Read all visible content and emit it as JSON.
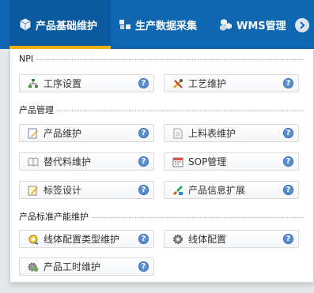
{
  "nav": {
    "tabs": [
      {
        "label": "",
        "active": false
      },
      {
        "label": "产品基础维护",
        "active": true,
        "icon": "cube-icon"
      },
      {
        "label": "生产数据采集",
        "active": false,
        "icon": "cube-stack-icon"
      },
      {
        "label": "WMS管理",
        "active": false,
        "icon": "cubes-icon"
      }
    ],
    "next_icon": "chevron-right-icon"
  },
  "colors": {
    "nav_bg": "#0f66b1",
    "active_underline": "#f2b211",
    "help": "#5b8fd0"
  },
  "sections": [
    {
      "title": "NPI",
      "items": [
        {
          "label": "工序设置",
          "icon": "tree-structure-icon"
        },
        {
          "label": "工艺维护",
          "icon": "tools-icon"
        }
      ]
    },
    {
      "title": "产品管理",
      "items": [
        {
          "label": "产品维护",
          "icon": "edit-document-icon"
        },
        {
          "label": "上料表维护",
          "icon": "document-icon"
        },
        {
          "label": "替代料维护",
          "icon": "book-icon"
        },
        {
          "label": "SOP管理",
          "icon": "calendar-icon"
        },
        {
          "label": "标签设计",
          "icon": "label-edit-icon"
        },
        {
          "label": "产品信息扩展",
          "icon": "palette-brush-icon"
        }
      ]
    },
    {
      "title": "产品标准产能维护",
      "items": [
        {
          "label": "线体配置类型维护",
          "icon": "gear-wrench-icon"
        },
        {
          "label": "线体配置",
          "icon": "gear-icon"
        },
        {
          "label": "产品工时维护",
          "icon": "gear-clock-icon"
        }
      ]
    }
  ]
}
